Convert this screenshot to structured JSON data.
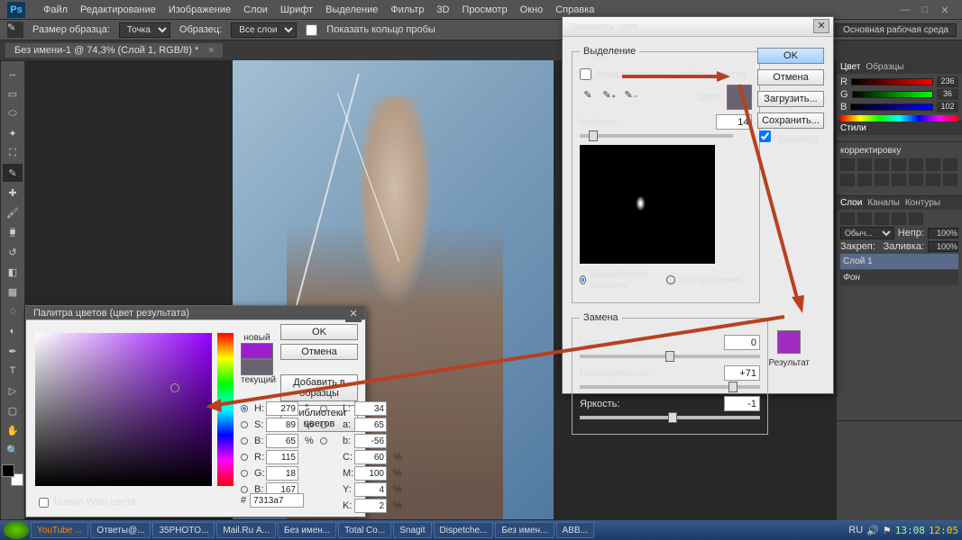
{
  "menubar": [
    "Файл",
    "Редактирование",
    "Изображение",
    "Слои",
    "Шрифт",
    "Выделение",
    "Фильтр",
    "3D",
    "Просмотр",
    "Окно",
    "Справка"
  ],
  "optbar": {
    "sample": "Размер образца:",
    "sample_val": "Точка",
    "sample_from": "Образец:",
    "sample_from_val": "Все слои",
    "ring": "Показать кольцо пробы",
    "workspace": "Основная рабочая среда"
  },
  "doctab": "Без имени-1 @ 74,3% (Слой 1, RGB/8) *",
  "replace": {
    "title": "Заменить цвет",
    "selection": "Выделение",
    "local": "Локализованные наборы цветов",
    "color": "Цвет:",
    "spread": "Разброс:",
    "spread_val": "14",
    "mode_sel": "Выделенная область",
    "mode_img": "Изображение",
    "replace_group": "Замена",
    "hue": "Цветовой тон:",
    "hue_val": "0",
    "sat": "Насыщенность:",
    "sat_val": "+71",
    "light": "Яркость:",
    "light_val": "-1",
    "result": "Результат",
    "ok": "OK",
    "cancel": "Отмена",
    "load": "Загрузить...",
    "save": "Сохранить...",
    "preview": "Просмотр"
  },
  "picker": {
    "title": "Палитра цветов (цвет результата)",
    "new": "новый",
    "current": "текущий",
    "ok": "OK",
    "cancel": "Отмена",
    "add": "Добавить в образцы",
    "libs": "Библиотеки цветов",
    "webonly": "Только Web-цвета",
    "H": "279",
    "S": "89",
    "Bv": "65",
    "R": "115",
    "G": "18",
    "B": "167",
    "L": "34",
    "a": "65",
    "b": "-56",
    "C": "60",
    "M": "100",
    "Y": "4",
    "K": "2",
    "hex": "7313a7"
  },
  "panels": {
    "color_tabs": [
      "Цвет",
      "Образцы"
    ],
    "styles_tab": "Стили",
    "adjust": "корректировку",
    "r": "236",
    "g": "36",
    "b": "102",
    "layers_tabs": [
      "Слои",
      "Каналы",
      "Контуры"
    ],
    "mode": "Обыч...",
    "opacity_lbl": "Непр:",
    "opacity": "100%",
    "fill_lbl": "Заливка:",
    "fill": "100%",
    "lock_lbl": "Закреп:",
    "layer1": "Слой 1",
    "bg": "Фон"
  },
  "taskbar": {
    "items": [
      "YouTube ...",
      "Ответы@...",
      "35PHOTO...",
      "Mail.Ru А...",
      "Без имен...",
      "Total Co...",
      "Snagit",
      "Dispetche...",
      "Без имен...",
      "ABB..."
    ],
    "lang": "RU",
    "time": "13:08",
    "time2": "12:05"
  }
}
